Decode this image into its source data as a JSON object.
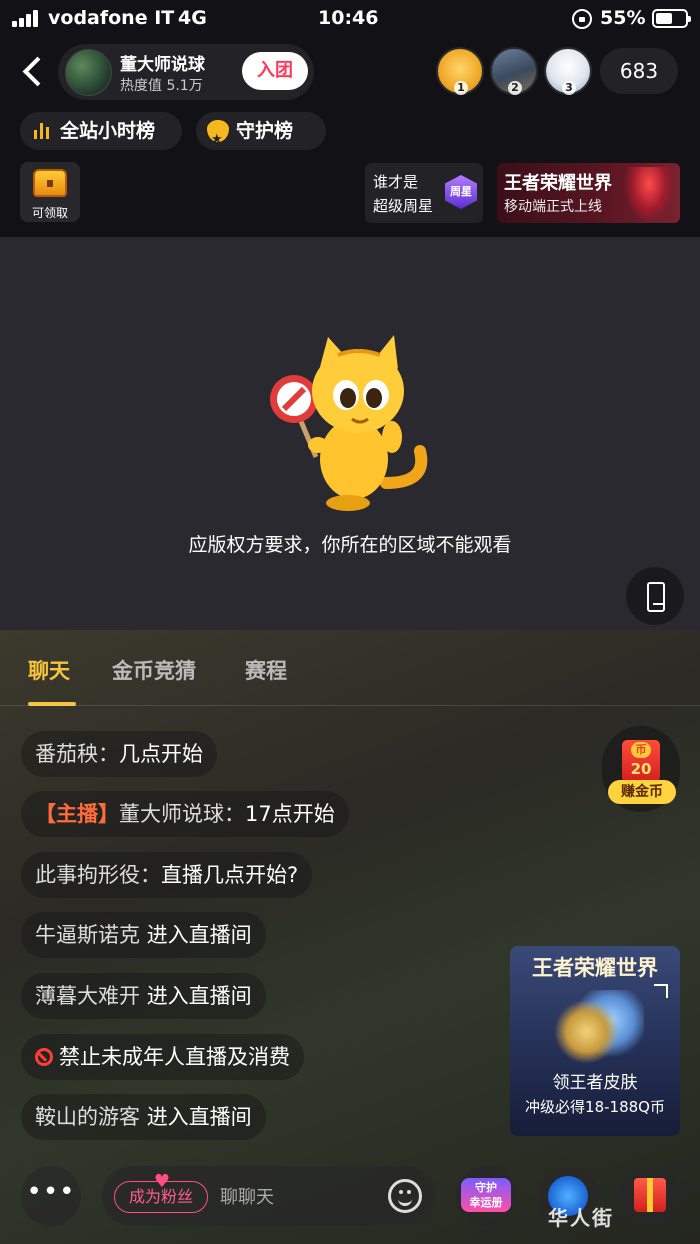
{
  "status_bar": {
    "carrier": "vodafone IT",
    "network": "4G",
    "time": "10:46",
    "battery": "55%"
  },
  "header": {
    "anchor_name": "董大师说球",
    "heat": "热度值 5.1万",
    "join_label": "入团",
    "ranks": [
      "1",
      "2",
      "3"
    ],
    "viewer_count": "683",
    "rank_pill": "全站小时榜",
    "guard_pill": "守护榜",
    "chest_label": "可领取",
    "star_line1": "谁才是",
    "star_line2": "超级周星",
    "star_badge": "周星",
    "game_banner_title": "王者荣耀世界",
    "game_banner_sub": "移动端正式上线"
  },
  "video": {
    "message": "应版权方要求，你所在的区域不能观看"
  },
  "tabs": [
    {
      "label": "聊天",
      "active": true
    },
    {
      "label": "金币竞猜",
      "active": false
    },
    {
      "label": "赛程",
      "active": false
    }
  ],
  "chat": {
    "messages": [
      {
        "user": "番茄秧",
        "sep": "：",
        "text": "几点开始"
      },
      {
        "host_tag": "【主播】",
        "user": "董大师说球",
        "sep": "：",
        "text": "17点开始"
      },
      {
        "user": "此事拘形役",
        "sep": "：",
        "text": "直播几点开始?"
      },
      {
        "user": "牛逼斯诺克",
        "text": "进入直播间"
      },
      {
        "user": "薄暮大难开",
        "text": "进入直播间"
      },
      {
        "text": "禁止未成年人直播及消费"
      },
      {
        "user": "鞍山的游客",
        "text": "进入直播间"
      }
    ]
  },
  "coin_widget": {
    "amount": "20",
    "label": "赚金币"
  },
  "promo": {
    "title": "王者荣耀世界",
    "line1": "领王者皮肤",
    "line2": "冲级必得18-188Q币"
  },
  "bottom": {
    "more_label": "•••",
    "fan_label": "成为粉丝",
    "chat_placeholder": "聊聊天",
    "guard_label_1": "守护",
    "guard_label_2": "幸运册"
  },
  "watermark": "华人街"
}
